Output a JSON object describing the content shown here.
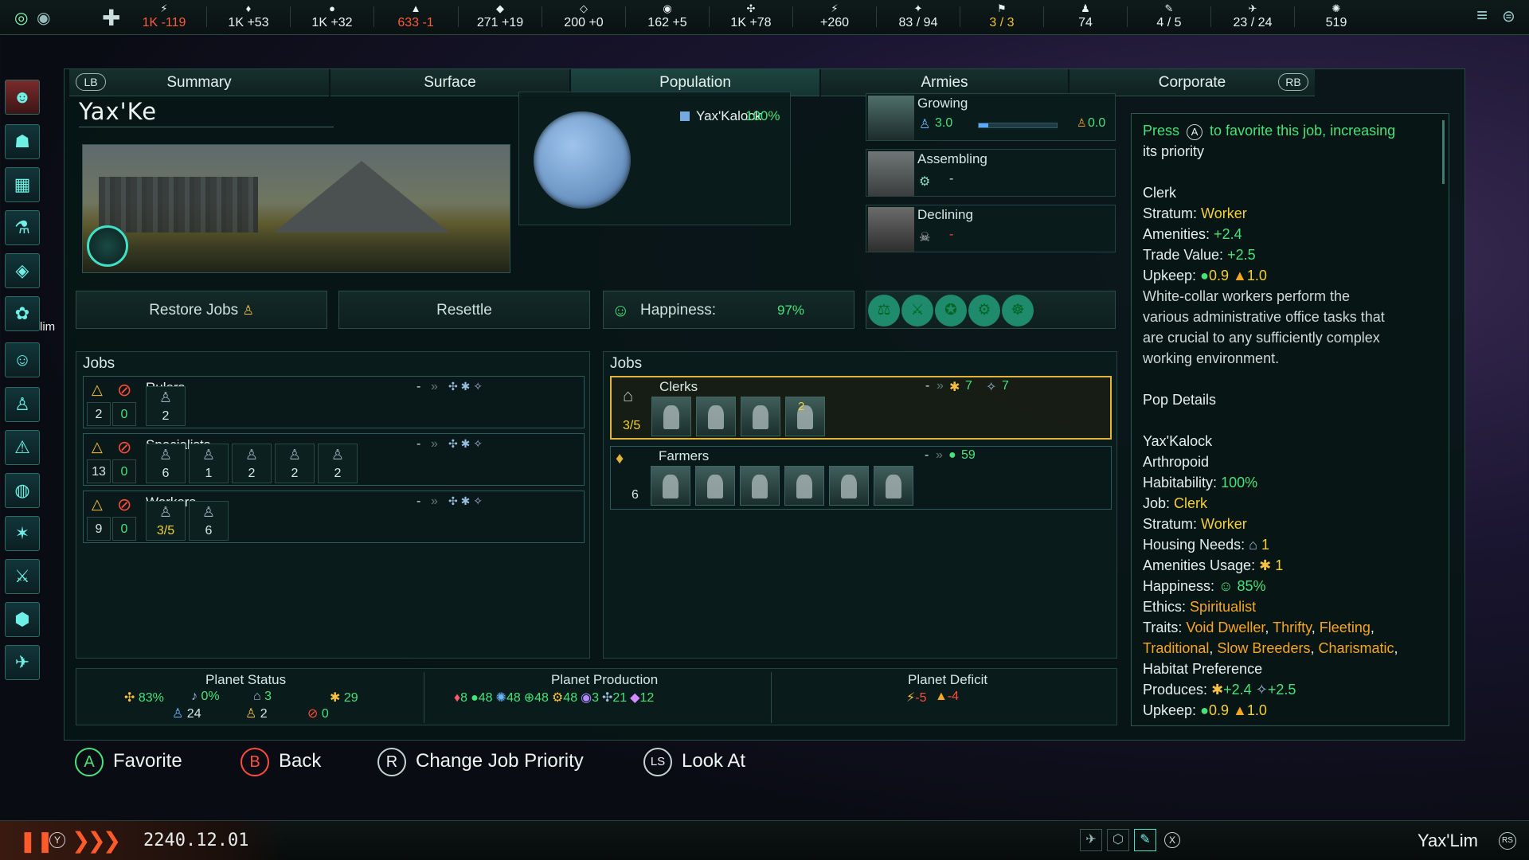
{
  "resources": [
    {
      "icon": "energy-icon",
      "glyph": "⚡",
      "value": "1K -119",
      "neg": true
    },
    {
      "icon": "minerals-icon",
      "glyph": "♦",
      "value": "1K +53",
      "neg": false
    },
    {
      "icon": "food-icon",
      "glyph": "●",
      "value": "1K +32",
      "neg": false
    },
    {
      "icon": "consumer-goods-icon",
      "glyph": "▲",
      "value": "633 -1",
      "neg": true
    },
    {
      "icon": "alloys-icon",
      "glyph": "◆",
      "value": "271 +19",
      "neg": false
    },
    {
      "icon": "influence-icon",
      "glyph": "◇",
      "value": "200 +0",
      "neg": false
    },
    {
      "icon": "unity-icon",
      "glyph": "◉",
      "value": "162 +5",
      "neg": false
    },
    {
      "icon": "research-icon",
      "glyph": "✣",
      "value": "1K +78",
      "neg": false
    },
    {
      "icon": "amenities-icon",
      "glyph": "⚡",
      "value": "+260",
      "neg": false
    },
    {
      "icon": "naval-capacity-icon",
      "glyph": "✦",
      "value": "83 / 94",
      "neg": false
    },
    {
      "icon": "starbase-icon",
      "glyph": "⚑",
      "value": "3 / 3",
      "warn": true
    },
    {
      "icon": "pop-icon",
      "glyph": "♟",
      "value": "74",
      "neg": false
    },
    {
      "icon": "envoys-icon",
      "glyph": "✎",
      "value": "4 / 5",
      "neg": false
    },
    {
      "icon": "fleet-icon",
      "glyph": "✈",
      "value": "23 / 24",
      "neg": false
    },
    {
      "icon": "tech-icon",
      "glyph": "✺",
      "value": "519",
      "neg": false
    }
  ],
  "tabs": {
    "lb": "LB",
    "rb": "RB",
    "summary": "Summary",
    "surface": "Surface",
    "population": "Population",
    "armies": "Armies",
    "corporate": "Corporate"
  },
  "planet": {
    "name": "Yax'Ke",
    "species_name": "Yax'Kalock",
    "species_pct": "100%",
    "sidebar_label": "lim"
  },
  "growth": {
    "growing": {
      "label": "Growing",
      "value": "3.0",
      "progress": 0.12,
      "rate": "0.0"
    },
    "assembling": {
      "label": "Assembling",
      "value": "-"
    },
    "declining": {
      "label": "Declining",
      "value": "-"
    }
  },
  "buttons": {
    "restore_jobs": "Restore Jobs",
    "resettle": "Resettle",
    "happiness_label": "Happiness:",
    "happiness_value": "97%"
  },
  "jobs_left": {
    "title": "Jobs",
    "strata": [
      {
        "name": "Rulers",
        "total": "2",
        "unemployed": "0",
        "dash": "-",
        "slots": [
          {
            "count": "2"
          }
        ]
      },
      {
        "name": "Specialists",
        "total": "13",
        "unemployed": "0",
        "dash": "-",
        "slots": [
          {
            "count": "6"
          },
          {
            "count": "1"
          },
          {
            "count": "2"
          },
          {
            "count": "2"
          },
          {
            "count": "2"
          }
        ]
      },
      {
        "name": "Workers",
        "total": "9",
        "unemployed": "0",
        "dash": "-",
        "slots": [
          {
            "count": "3/5"
          },
          {
            "count": "6"
          }
        ]
      }
    ]
  },
  "jobs_right": {
    "title": "Jobs",
    "jobs": [
      {
        "name": "Clerks",
        "filled": "3/5",
        "dash": "-",
        "prod1": "7",
        "prod2": "7",
        "pops": 4,
        "badge": "2"
      },
      {
        "name": "Farmers",
        "filled": "6",
        "dash": "-",
        "prod1": "59",
        "pops": 6
      }
    ]
  },
  "status": {
    "status_title": "Planet Status",
    "production_title": "Planet Production",
    "deficit_title": "Planet Deficit",
    "stability": "83%",
    "crime": "0%",
    "housing": "3",
    "amenities": "29",
    "pops": "24",
    "free_housing": "2",
    "unemployed": "0",
    "production": [
      "8",
      "48",
      "48",
      "48",
      "48",
      "3",
      "21",
      "12"
    ],
    "deficit_energy": "-5",
    "deficit_goods": "-4"
  },
  "tooltip": {
    "press": "Press",
    "a": "A",
    "press_rest": "to favorite this job, increasing",
    "press_rest2": "its priority",
    "job_title": "Clerk",
    "stratum_label": "Stratum:",
    "stratum_value": "Worker",
    "amenities_label": "Amenities:",
    "amenities_value": "+2.4",
    "trade_label": "Trade Value:",
    "trade_value": "+2.5",
    "upkeep_label": "Upkeep:",
    "upkeep_food": "0.9",
    "upkeep_goods": "1.0",
    "desc1": "White-collar workers perform the",
    "desc2": "various administrative office tasks that",
    "desc3": "are crucial to any sufficiently complex",
    "desc4": "working environment.",
    "pop_details": "Pop Details",
    "species": "Yax'Kalock",
    "phenotype": "Arthropoid",
    "habitability_label": "Habitability:",
    "habitability_value": "100%",
    "job_label": "Job:",
    "job_value": "Clerk",
    "stratum2_label": "Stratum:",
    "stratum2_value": "Worker",
    "housing_label": "Housing Needs:",
    "housing_value": "1",
    "amen_usage_label": "Amenities Usage:",
    "amen_usage_value": "1",
    "happiness_label": "Happiness:",
    "happiness_value": "85%",
    "ethics_label": "Ethics:",
    "ethics_value": "Spiritualist",
    "traits_label": "Traits:",
    "trait1": "Void Dweller",
    "trait2": "Thrifty",
    "trait3": "Fleeting",
    "trait4": "Traditional",
    "trait5": "Slow Breeders",
    "trait6": "Charismatic",
    "trait7": "Habitat Preference",
    "produces_label": "Produces:",
    "produces_amen": "+2.4",
    "produces_trade": "+2.5",
    "upkeep2_label": "Upkeep:",
    "upkeep2_food": "0.9",
    "upkeep2_goods": "1.0"
  },
  "hints": {
    "a": "A",
    "favorite": "Favorite",
    "b": "B",
    "back": "Back",
    "r": "R",
    "priority": "Change Job Priority",
    "ls": "LS",
    "look": "Look At"
  },
  "bottom": {
    "y": "Y",
    "date": "2240.12.01",
    "x": "X",
    "empire": "Yax'Lim",
    "rs": "RS"
  }
}
